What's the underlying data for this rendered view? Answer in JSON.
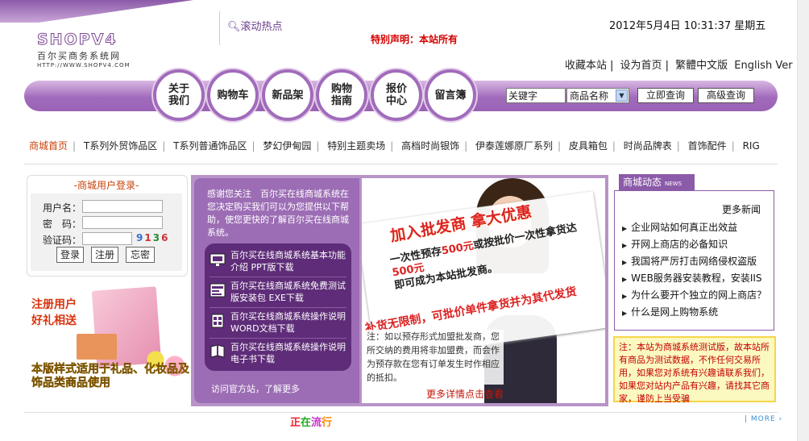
{
  "logo": {
    "main": "SHOPV4",
    "subtitle": "百尔买商务系统网",
    "url": "HTTP://WWW.SHOPV4.COM"
  },
  "header": {
    "hot_label": "滚动热点",
    "hot_text": "特别声明：本站所有",
    "datetime": "2012年5月4日  10:31:37 星期五",
    "links": [
      "收藏本站",
      "设为首页",
      "繁體中文版",
      "English Ver"
    ],
    "link_sep": "|"
  },
  "nav": {
    "items": [
      "关于\n我们",
      "购物车",
      "新品架",
      "购物\n指南",
      "报价\n中心",
      "留言簿"
    ]
  },
  "search": {
    "keyword_value": "关键字",
    "select_value": "商品名称",
    "search_button": "立即查询",
    "advanced_button": "高级查询"
  },
  "categories": [
    "商城首页",
    "T系列外贸饰品区",
    "T系列普通饰品区",
    "梦幻伊甸园",
    "特别主题卖场",
    "高档时尚银饰",
    "伊泰莲娜原厂系列",
    "皮具箱包",
    "时尚品牌表",
    "首饰配件",
    "RIG"
  ],
  "login": {
    "title": "-商城用户登录-",
    "username_label": "用户名：",
    "password_label": "密　码：",
    "captcha_label": "验证码：",
    "captcha_digits": [
      "9",
      "1",
      "3",
      "6"
    ],
    "buttons": [
      "登录",
      "注册",
      "忘密"
    ]
  },
  "promo": {
    "line1": "注册用户",
    "line2": "好礼相送",
    "line3": "本版样式适用于礼品、化妆品及饰品类商品使用"
  },
  "intro": {
    "text": "感谢您关注　百尔买在线商城系统在您决定购买我们可以为您提供以下帮助，使您更快的了解百尔买在线商城系统。",
    "downloads": [
      "百尔买在线商城系统基本功能介绍 PPT版下载",
      "百尔买在线商城系统免费测试版安装包 EXE下载",
      "百尔买在线商城系统操作说明 WORD文档下载",
      "百尔买在线商城系统操作说明 电子书下载"
    ],
    "visit": "访问官方站，了解更多"
  },
  "banner": {
    "headline": "加入批发商 拿大优惠",
    "line_a": "一次性预存",
    "line_a_red": "500元",
    "line_a2": "或按批价一次性拿货达",
    "line_a3": "500元",
    "line_b": "即可成为本站批发商。",
    "line_c": "补货无限制，可批价单件拿货并为其代发货",
    "note": "注：如以预存形式加盟批发商，您所交纳的费用将非加盟费，而会作为预存款在您有订单发生时作相应的抵扣。",
    "more": "更多详情点击查看"
  },
  "news": {
    "tab": "商城动态",
    "tab_badge": "NEWS",
    "more": "更多新闻",
    "items": [
      "企业网站如何真正出效益",
      "开网上商店的必备知识",
      "我国将严厉打击网络侵权盗版",
      "WEB服务器安装教程，安装IIS",
      "为什么要开个独立的网上商店？",
      "什么是网上购物系统"
    ],
    "notice": "注：本站为商城系统测试版，故本站所有商品为测试数据，不作任何交易所用，如果您对系统有兴趣请联系我们，如果您对站内产品有兴趣，请找其它商家，谨防上当受骗"
  },
  "bottom": {
    "trend_chars": [
      "正",
      "在",
      "流",
      "行"
    ],
    "more": "| MORE ›"
  },
  "colors": {
    "purple": "#8b5aa8",
    "dark_purple": "#5e2c78",
    "accent_orange": "#c8410a",
    "notice_red": "#c40000"
  }
}
